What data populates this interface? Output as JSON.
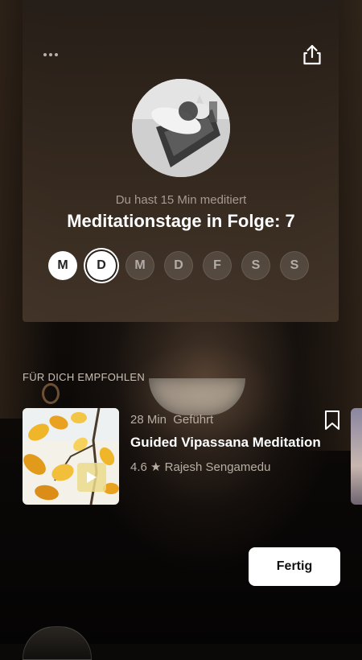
{
  "header": {
    "more_icon": "more-dots-icon",
    "share_icon": "share-upload-icon"
  },
  "summary": {
    "subtitle": "Du hast 15 Min meditiert",
    "title": "Meditationstage in Folge: 7",
    "days": [
      {
        "label": "M",
        "state": "done"
      },
      {
        "label": "D",
        "state": "today"
      },
      {
        "label": "M",
        "state": "pending"
      },
      {
        "label": "D",
        "state": "pending"
      },
      {
        "label": "F",
        "state": "pending"
      },
      {
        "label": "S",
        "state": "pending"
      },
      {
        "label": "S",
        "state": "pending"
      }
    ]
  },
  "recommendations": {
    "section_label": "FÜR DICH EMPFOHLEN",
    "items": [
      {
        "duration": "28 Min",
        "type": "Geführt",
        "title": "Guided Vipassana Meditation",
        "rating": "4.6",
        "star": "★",
        "author": "Rajesh Sengamedu",
        "bookmark_icon": "bookmark-icon",
        "play_icon": "play-icon"
      }
    ]
  },
  "actions": {
    "done_label": "Fertig"
  },
  "colors": {
    "accent_text": "#a79b8f",
    "button_bg": "#ffffff"
  }
}
